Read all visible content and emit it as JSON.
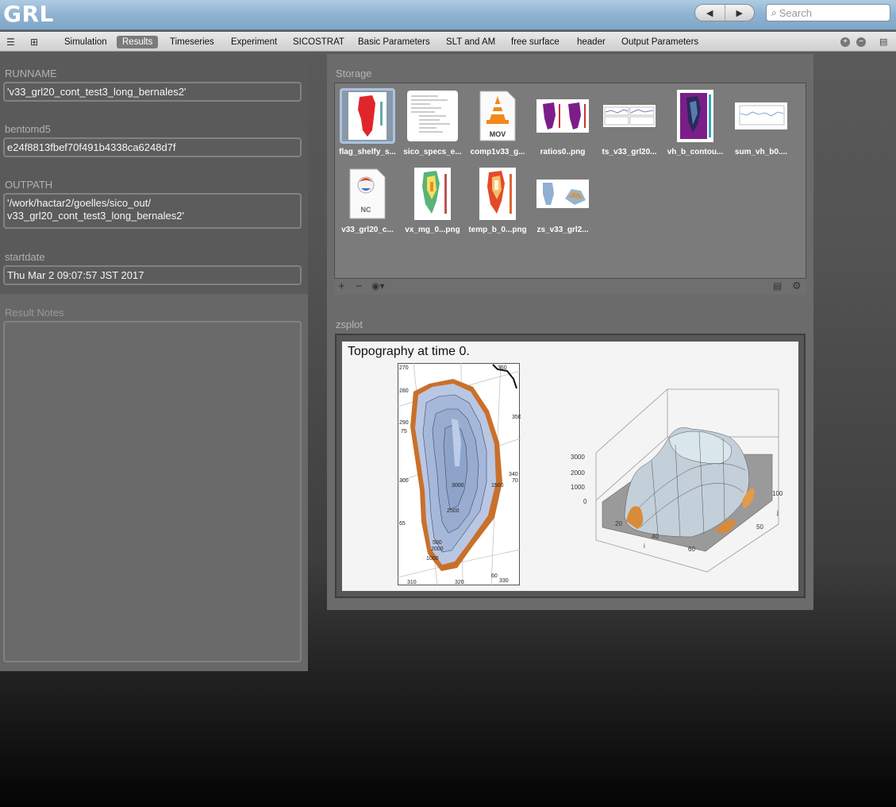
{
  "app": {
    "title": "GRL"
  },
  "nav": {
    "back": "◀",
    "forward": "▶"
  },
  "search": {
    "placeholder": "Search"
  },
  "tabs": [
    {
      "label": "Simulation"
    },
    {
      "label": "Results",
      "active": true
    },
    {
      "label": "Timeseries"
    },
    {
      "label": "Experiment"
    },
    {
      "label": "SICOSTRAT"
    },
    {
      "label": "Basic Parameters"
    },
    {
      "label": "SLT and AM"
    },
    {
      "label": "free surface"
    },
    {
      "label": "header"
    },
    {
      "label": "Output Parameters"
    }
  ],
  "fields": {
    "runname": {
      "label": "RUNNAME",
      "value": "'v33_grl20_cont_test3_long_bernales2'"
    },
    "bentomd5": {
      "label": "bentomd5",
      "value": "e24f8813fbef70f491b4338ca6248d7f"
    },
    "outpath": {
      "label": "OUTPATH",
      "value_line1": "'/work/hactar2/goelles/sico_out/",
      "value_line2": "v33_grl20_cont_test3_long_bernales2'"
    },
    "startdate": {
      "label": "startdate",
      "value": "Thu Mar 2 09:07:57 JST 2017"
    }
  },
  "notes": {
    "label": "Result Notes"
  },
  "storage": {
    "label": "Storage",
    "files": [
      {
        "name": "flag_shelfy_s...",
        "icon": "red-greenland-map-thumbnail"
      },
      {
        "name": "sico_specs_e...",
        "icon": "text-document-thumbnail"
      },
      {
        "name": "comp1v33_g...",
        "icon": "vlc-mov-file-icon",
        "badge": "MOV"
      },
      {
        "name": "ratios0..png",
        "icon": "purple-maps-thumbnail"
      },
      {
        "name": "ts_v33_grl20...",
        "icon": "timeseries-plots-thumbnail"
      },
      {
        "name": "vh_b_contou...",
        "icon": "purple-contour-map-thumbnail"
      },
      {
        "name": "sum_vh_b0....",
        "icon": "line-plot-thumbnail"
      },
      {
        "name": "v33_grl20_c...",
        "icon": "netcdf-file-icon",
        "badge": "NC"
      },
      {
        "name": "vx_mg_0...png",
        "icon": "velocity-map-thumbnail"
      },
      {
        "name": "temp_b_0...png",
        "icon": "temperature-map-thumbnail"
      },
      {
        "name": "zs_v33_grl2...",
        "icon": "topography-plot-thumbnail"
      }
    ]
  },
  "zsplot": {
    "label": "zsplot",
    "title": "Topography at time 0.",
    "map_lon_labels": [
      "270",
      "280",
      "290",
      "300",
      "310",
      "320",
      "330",
      "340",
      "350",
      "360",
      "70"
    ],
    "map_lat_labels": [
      "75",
      "65",
      "60"
    ],
    "map_contour_labels": [
      "3000",
      "2500",
      "2000",
      "1500",
      "1000",
      "500"
    ],
    "surf_z_ticks": [
      "3000",
      "2000",
      "1000",
      "0"
    ],
    "surf_i_ticks": [
      "20",
      "40",
      "60"
    ],
    "surf_j_ticks": [
      "50",
      "100"
    ],
    "surf_i_label": "i",
    "surf_j_label": "j"
  },
  "colors": {
    "titlebar": "#8fb2d1",
    "active_tab": "#7a7a7a",
    "selection": "#aac3df"
  }
}
